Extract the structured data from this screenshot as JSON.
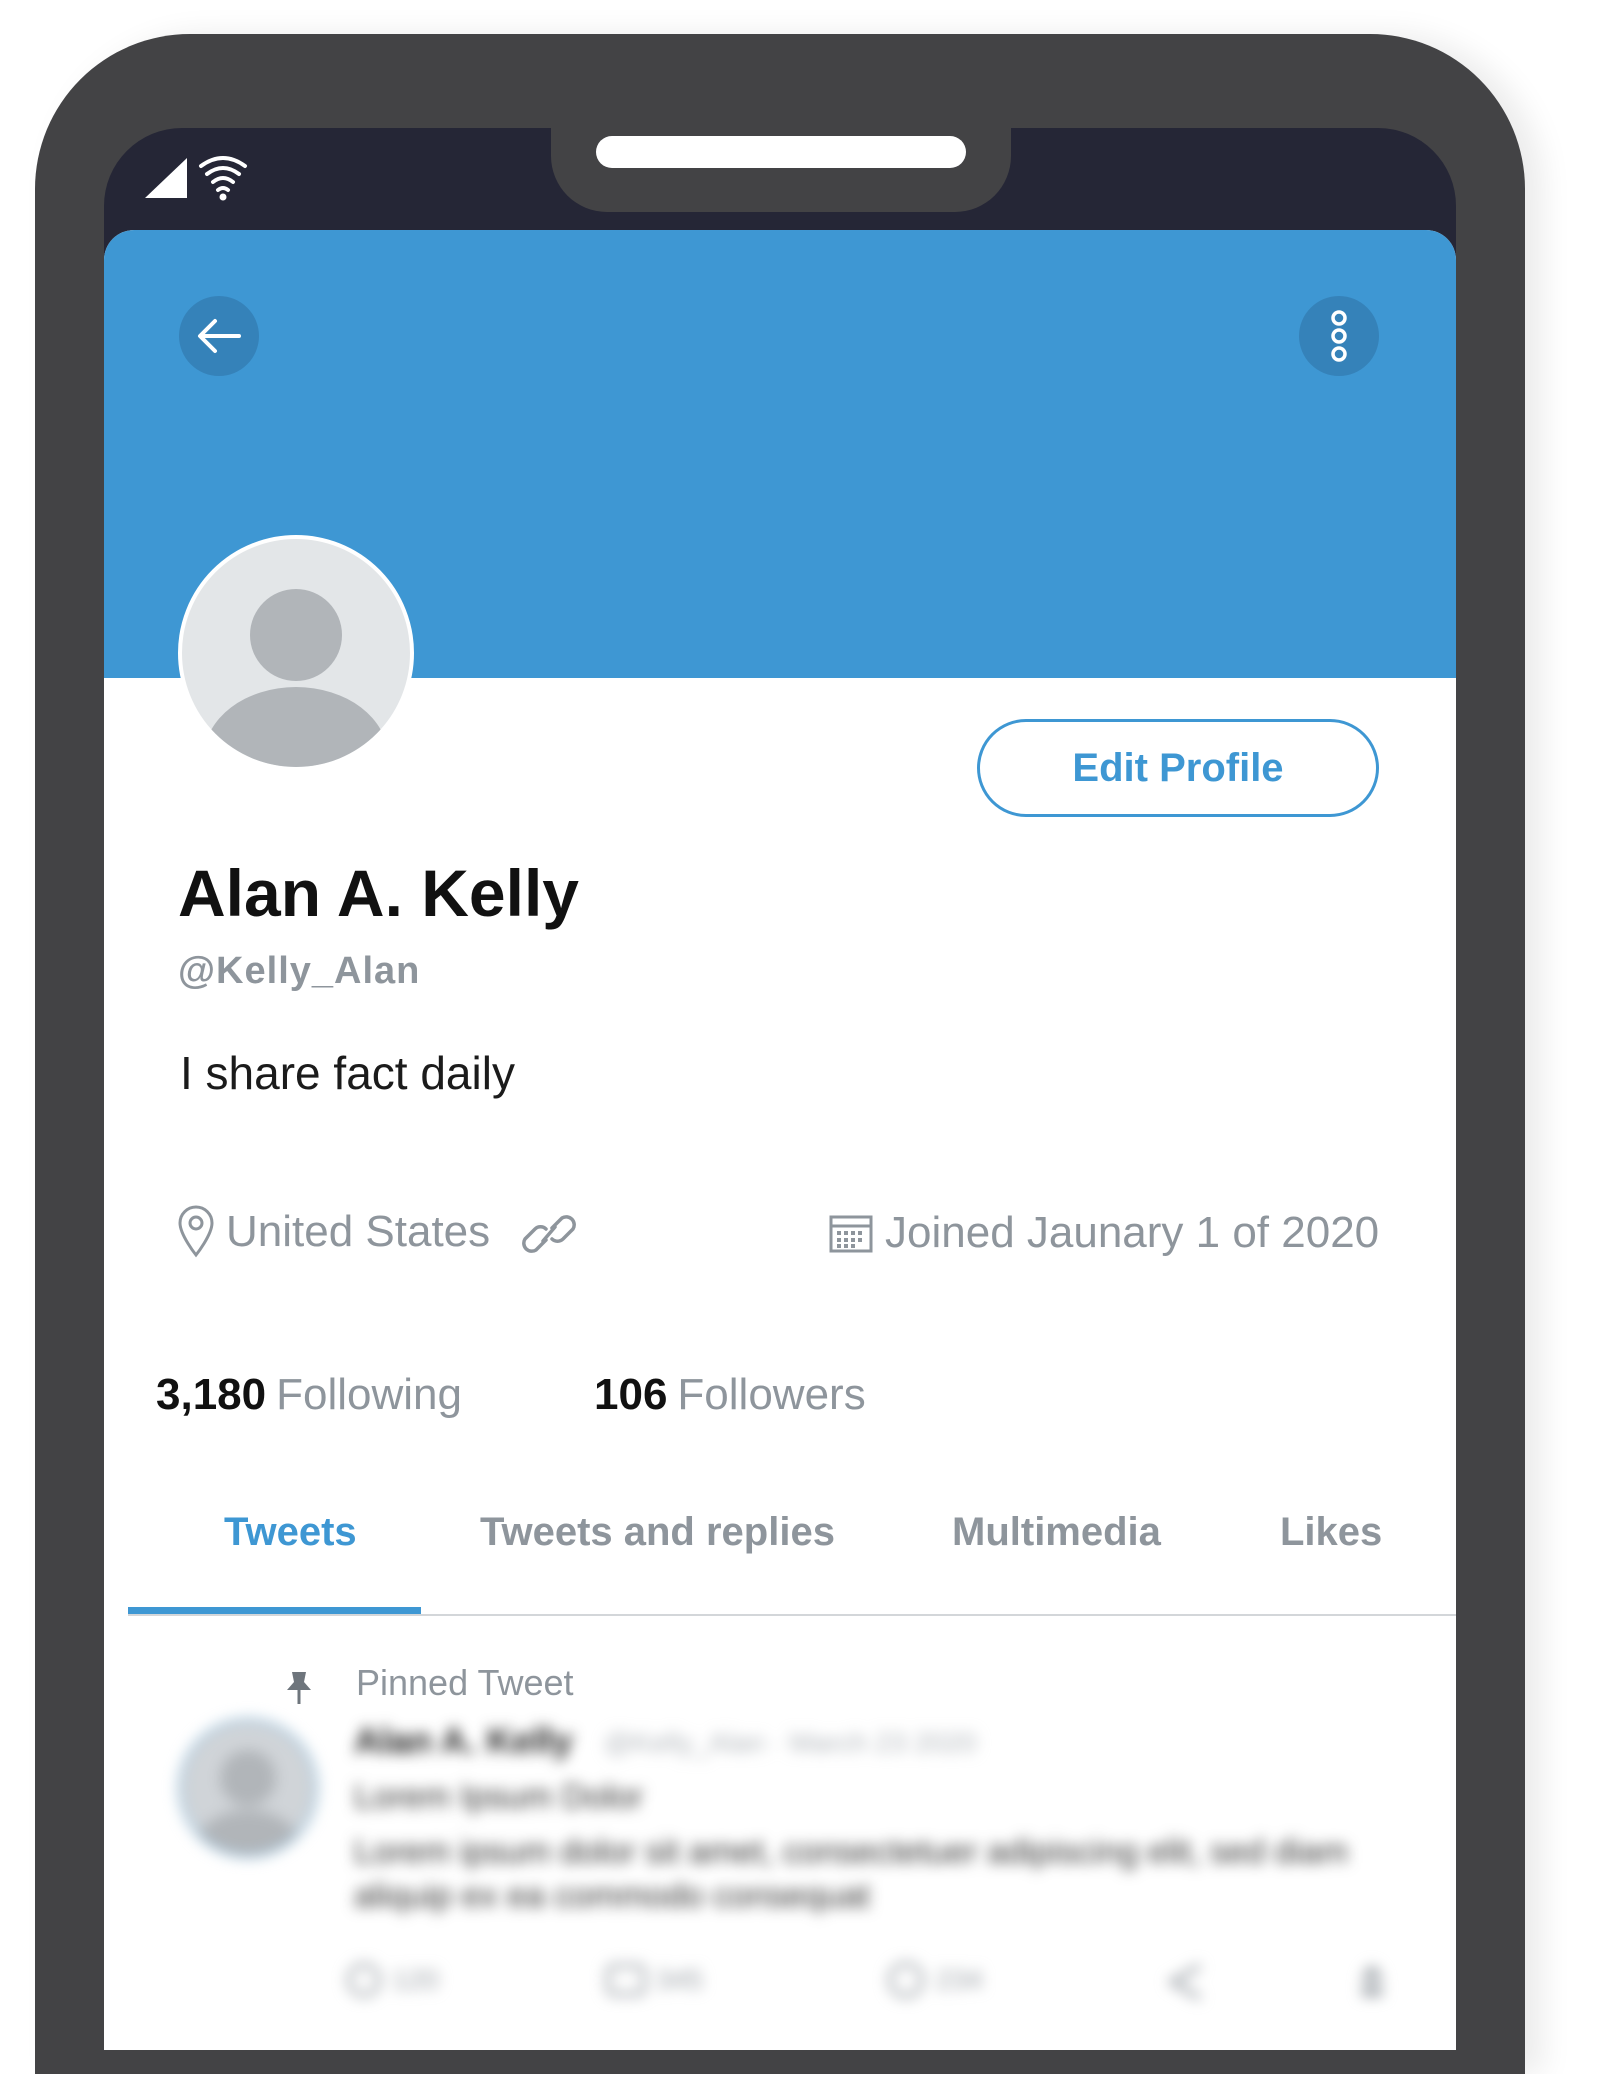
{
  "colors": {
    "accent": "#3e97d3",
    "banner": "#3e97d3",
    "muted_text": "#8e959c",
    "phone_frame": "#434345"
  },
  "status_bar": {
    "icons": [
      "signal-icon",
      "wifi-icon"
    ]
  },
  "header": {
    "back_icon": "arrow-left-icon",
    "more_icon": "more-vertical-icon"
  },
  "profile": {
    "edit_button_label": "Edit Profile",
    "name": "Alan A. Kelly",
    "handle": "@Kelly_Alan",
    "bio": "I share fact daily",
    "location": "United States",
    "joined": "Joined Jaunary 1 of 2020",
    "following_count": "3,180",
    "following_label": "Following",
    "followers_count": "106",
    "followers_label": "Followers"
  },
  "tabs": [
    {
      "label": "Tweets",
      "active": true
    },
    {
      "label": "Tweets and replies",
      "active": false
    },
    {
      "label": "Multimedia",
      "active": false
    },
    {
      "label": "Likes",
      "active": false
    }
  ],
  "pinned_tweet": {
    "label": "Pinned Tweet",
    "author": "Alan A. Kelly",
    "meta": "@Kelly_Alan · March 23 2020",
    "title": "Lorem Ipsum Dolor",
    "body": "Lorem ipsum dolor sit amet, consectetuer adipiscing elit, sed diam aliquip ex ea commodo consequat",
    "reply_count": "120",
    "retweet_count": "345",
    "like_count": "234"
  }
}
